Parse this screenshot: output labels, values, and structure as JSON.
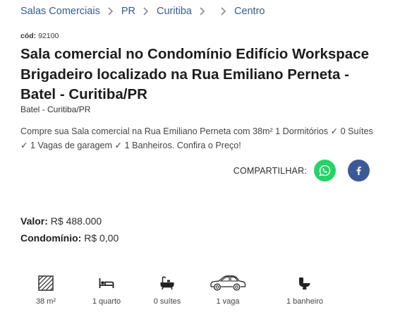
{
  "breadcrumb": {
    "items": [
      "Salas Comerciais",
      "PR",
      "Curitiba",
      "",
      "Centro"
    ]
  },
  "listing": {
    "code_label": "cód:",
    "code_value": "92100",
    "title": "Sala comercial no Condomínio Edifício Workspace Brigadeiro localizado na Rua Emiliano Perneta - Batel - Curitiba/PR",
    "location": "Batel - Curitiba/PR",
    "description": "Compre sua Sala comercial na Rua Emiliano Perneta com 38m² 1 Dormitórios ✓ 0 Suítes ✓ 1 Vagas de garagem ✓ 1 Banheiros. Confira o Preço!"
  },
  "share": {
    "label": "COMPARTILHAR:",
    "buttons": [
      {
        "name": "whatsapp",
        "icon": "whatsapp-icon",
        "color": "#25d366"
      },
      {
        "name": "facebook",
        "icon": "facebook-icon",
        "color": "#3b5998"
      }
    ]
  },
  "prices": {
    "valor_label": "Valor:",
    "valor": "R$ 488.000",
    "condominio_label": "Condomínio:",
    "condominio": "R$ 0,00"
  },
  "features": [
    {
      "icon": "area-icon",
      "text": "38 m²"
    },
    {
      "icon": "bed-icon",
      "text": "1 quarto"
    },
    {
      "icon": "bathtub-icon",
      "text": "0 suítes"
    },
    {
      "icon": "car-icon",
      "text": "1 vaga"
    },
    {
      "icon": "toilet-icon",
      "text": "1 banheiro"
    }
  ]
}
